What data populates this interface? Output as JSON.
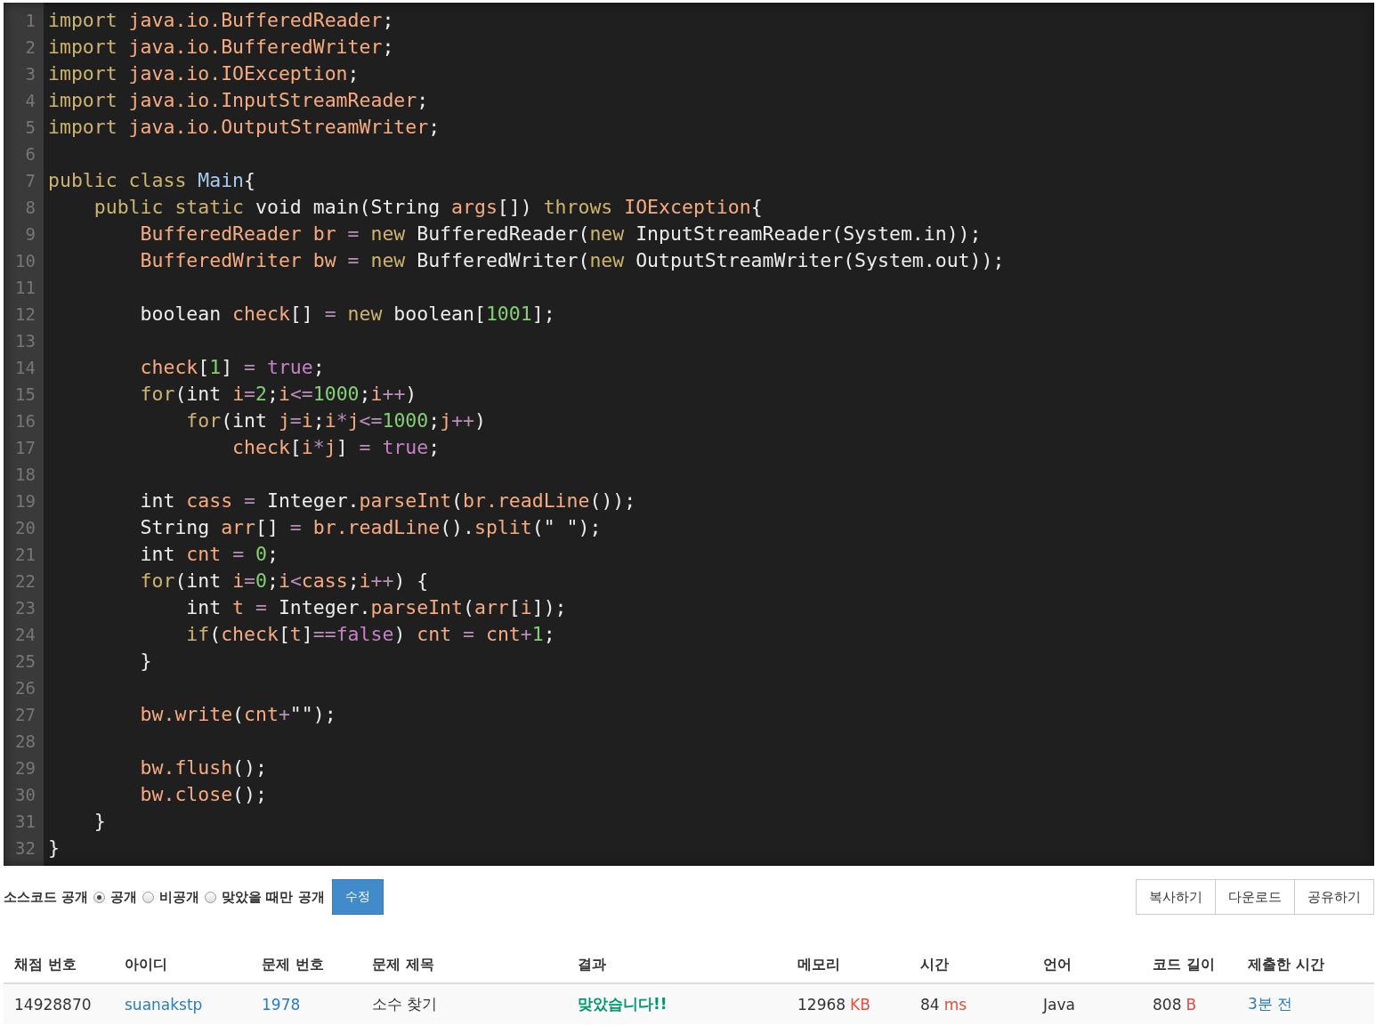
{
  "code_editor": {
    "lines": [
      {
        "number": "1",
        "tokens": [
          {
            "kind": "keyword",
            "text": "import "
          },
          {
            "kind": "variable",
            "text": "java.io.BufferedReader"
          },
          {
            "kind": "plain",
            "text": ";"
          }
        ]
      },
      {
        "number": "2",
        "tokens": [
          {
            "kind": "keyword",
            "text": "import "
          },
          {
            "kind": "variable",
            "text": "java.io.BufferedWriter"
          },
          {
            "kind": "plain",
            "text": ";"
          }
        ]
      },
      {
        "number": "3",
        "tokens": [
          {
            "kind": "keyword",
            "text": "import "
          },
          {
            "kind": "variable",
            "text": "java.io.IOException"
          },
          {
            "kind": "plain",
            "text": ";"
          }
        ]
      },
      {
        "number": "4",
        "tokens": [
          {
            "kind": "keyword",
            "text": "import "
          },
          {
            "kind": "variable",
            "text": "java.io.InputStreamReader"
          },
          {
            "kind": "plain",
            "text": ";"
          }
        ]
      },
      {
        "number": "5",
        "tokens": [
          {
            "kind": "keyword",
            "text": "import "
          },
          {
            "kind": "variable",
            "text": "java.io.OutputStreamWriter"
          },
          {
            "kind": "plain",
            "text": ";"
          }
        ]
      },
      {
        "number": "6"
      },
      {
        "number": "7",
        "tokens": [
          {
            "kind": "keyword",
            "text": "public class "
          },
          {
            "kind": "class",
            "text": "Main"
          },
          {
            "kind": "plain",
            "text": "{"
          }
        ]
      },
      {
        "number": "8",
        "tokens": [
          {
            "kind": "keyword",
            "text": "    public static "
          },
          {
            "kind": "plain",
            "text": "void main(String "
          },
          {
            "kind": "variable",
            "text": "args"
          },
          {
            "kind": "plain",
            "text": "[]) "
          },
          {
            "kind": "keyword",
            "text": "throws "
          },
          {
            "kind": "variable",
            "text": "IOException"
          },
          {
            "kind": "plain",
            "text": "{"
          }
        ]
      },
      {
        "number": "9",
        "tokens": [
          {
            "kind": "variable",
            "text": "        BufferedReader br "
          },
          {
            "kind": "operator",
            "text": "= "
          },
          {
            "kind": "keyword",
            "text": "new "
          },
          {
            "kind": "plain",
            "text": "BufferedReader("
          },
          {
            "kind": "keyword",
            "text": "new "
          },
          {
            "kind": "plain",
            "text": "InputStreamReader(System.in));"
          }
        ]
      },
      {
        "number": "10",
        "tokens": [
          {
            "kind": "variable",
            "text": "        BufferedWriter bw "
          },
          {
            "kind": "operator",
            "text": "= "
          },
          {
            "kind": "keyword",
            "text": "new "
          },
          {
            "kind": "plain",
            "text": "BufferedWriter("
          },
          {
            "kind": "keyword",
            "text": "new "
          },
          {
            "kind": "plain",
            "text": "OutputStreamWriter(System.out));"
          }
        ]
      },
      {
        "number": "11"
      },
      {
        "number": "12",
        "tokens": [
          {
            "kind": "plain",
            "text": "        boolean "
          },
          {
            "kind": "variable",
            "text": "check"
          },
          {
            "kind": "plain",
            "text": "[] "
          },
          {
            "kind": "operator",
            "text": "= "
          },
          {
            "kind": "keyword",
            "text": "new "
          },
          {
            "kind": "plain",
            "text": "boolean["
          },
          {
            "kind": "number",
            "text": "1001"
          },
          {
            "kind": "plain",
            "text": "];"
          }
        ]
      },
      {
        "number": "13"
      },
      {
        "number": "14",
        "tokens": [
          {
            "kind": "variable",
            "text": "        check"
          },
          {
            "kind": "plain",
            "text": "["
          },
          {
            "kind": "number",
            "text": "1"
          },
          {
            "kind": "plain",
            "text": "] "
          },
          {
            "kind": "operator",
            "text": "= "
          },
          {
            "kind": "literal",
            "text": "true"
          },
          {
            "kind": "plain",
            "text": ";"
          }
        ]
      },
      {
        "number": "15",
        "tokens": [
          {
            "kind": "keyword",
            "text": "        for"
          },
          {
            "kind": "plain",
            "text": "(int "
          },
          {
            "kind": "variable",
            "text": "i"
          },
          {
            "kind": "operator",
            "text": "="
          },
          {
            "kind": "number",
            "text": "2"
          },
          {
            "kind": "plain",
            "text": ";"
          },
          {
            "kind": "variable",
            "text": "i"
          },
          {
            "kind": "operator",
            "text": "<="
          },
          {
            "kind": "number",
            "text": "1000"
          },
          {
            "kind": "plain",
            "text": ";"
          },
          {
            "kind": "variable",
            "text": "i"
          },
          {
            "kind": "operator",
            "text": "++"
          },
          {
            "kind": "plain",
            "text": ")"
          }
        ]
      },
      {
        "number": "16",
        "tokens": [
          {
            "kind": "keyword",
            "text": "            for"
          },
          {
            "kind": "plain",
            "text": "(int "
          },
          {
            "kind": "variable",
            "text": "j"
          },
          {
            "kind": "operator",
            "text": "="
          },
          {
            "kind": "variable",
            "text": "i"
          },
          {
            "kind": "plain",
            "text": ";"
          },
          {
            "kind": "variable",
            "text": "i"
          },
          {
            "kind": "operator",
            "text": "*"
          },
          {
            "kind": "variable",
            "text": "j"
          },
          {
            "kind": "operator",
            "text": "<="
          },
          {
            "kind": "number",
            "text": "1000"
          },
          {
            "kind": "plain",
            "text": ";"
          },
          {
            "kind": "variable",
            "text": "j"
          },
          {
            "kind": "operator",
            "text": "++"
          },
          {
            "kind": "plain",
            "text": ")"
          }
        ]
      },
      {
        "number": "17",
        "tokens": [
          {
            "kind": "variable",
            "text": "                check"
          },
          {
            "kind": "plain",
            "text": "["
          },
          {
            "kind": "variable",
            "text": "i"
          },
          {
            "kind": "operator",
            "text": "*"
          },
          {
            "kind": "variable",
            "text": "j"
          },
          {
            "kind": "plain",
            "text": "] "
          },
          {
            "kind": "operator",
            "text": "= "
          },
          {
            "kind": "literal",
            "text": "true"
          },
          {
            "kind": "plain",
            "text": ";"
          }
        ]
      },
      {
        "number": "18"
      },
      {
        "number": "19",
        "tokens": [
          {
            "kind": "plain",
            "text": "        int "
          },
          {
            "kind": "variable",
            "text": "cass "
          },
          {
            "kind": "operator",
            "text": "= "
          },
          {
            "kind": "plain",
            "text": "Integer."
          },
          {
            "kind": "variable",
            "text": "parseInt"
          },
          {
            "kind": "plain",
            "text": "("
          },
          {
            "kind": "variable",
            "text": "br.readLine"
          },
          {
            "kind": "plain",
            "text": "());"
          }
        ]
      },
      {
        "number": "20",
        "tokens": [
          {
            "kind": "plain",
            "text": "        String "
          },
          {
            "kind": "variable",
            "text": "arr"
          },
          {
            "kind": "plain",
            "text": "[] "
          },
          {
            "kind": "operator",
            "text": "= "
          },
          {
            "kind": "variable",
            "text": "br.readLine"
          },
          {
            "kind": "plain",
            "text": "()."
          },
          {
            "kind": "variable",
            "text": "split"
          },
          {
            "kind": "plain",
            "text": "(\" \");"
          }
        ]
      },
      {
        "number": "21",
        "tokens": [
          {
            "kind": "plain",
            "text": "        int "
          },
          {
            "kind": "variable",
            "text": "cnt "
          },
          {
            "kind": "operator",
            "text": "= "
          },
          {
            "kind": "number",
            "text": "0"
          },
          {
            "kind": "plain",
            "text": ";"
          }
        ]
      },
      {
        "number": "22",
        "tokens": [
          {
            "kind": "keyword",
            "text": "        for"
          },
          {
            "kind": "plain",
            "text": "(int "
          },
          {
            "kind": "variable",
            "text": "i"
          },
          {
            "kind": "operator",
            "text": "="
          },
          {
            "kind": "number",
            "text": "0"
          },
          {
            "kind": "plain",
            "text": ";"
          },
          {
            "kind": "variable",
            "text": "i"
          },
          {
            "kind": "operator",
            "text": "<"
          },
          {
            "kind": "variable",
            "text": "cass"
          },
          {
            "kind": "plain",
            "text": ";"
          },
          {
            "kind": "variable",
            "text": "i"
          },
          {
            "kind": "operator",
            "text": "++"
          },
          {
            "kind": "plain",
            "text": ") {"
          }
        ]
      },
      {
        "number": "23",
        "tokens": [
          {
            "kind": "plain",
            "text": "            int "
          },
          {
            "kind": "variable",
            "text": "t "
          },
          {
            "kind": "operator",
            "text": "= "
          },
          {
            "kind": "plain",
            "text": "Integer."
          },
          {
            "kind": "variable",
            "text": "parseInt"
          },
          {
            "kind": "plain",
            "text": "("
          },
          {
            "kind": "variable",
            "text": "arr"
          },
          {
            "kind": "plain",
            "text": "["
          },
          {
            "kind": "variable",
            "text": "i"
          },
          {
            "kind": "plain",
            "text": "]);"
          }
        ]
      },
      {
        "number": "24",
        "tokens": [
          {
            "kind": "keyword",
            "text": "            if"
          },
          {
            "kind": "plain",
            "text": "("
          },
          {
            "kind": "variable",
            "text": "check"
          },
          {
            "kind": "plain",
            "text": "["
          },
          {
            "kind": "variable",
            "text": "t"
          },
          {
            "kind": "plain",
            "text": "]"
          },
          {
            "kind": "operator",
            "text": "=="
          },
          {
            "kind": "literal",
            "text": "false"
          },
          {
            "kind": "plain",
            "text": ") "
          },
          {
            "kind": "variable",
            "text": "cnt "
          },
          {
            "kind": "operator",
            "text": "= "
          },
          {
            "kind": "variable",
            "text": "cnt"
          },
          {
            "kind": "operator",
            "text": "+"
          },
          {
            "kind": "number",
            "text": "1"
          },
          {
            "kind": "plain",
            "text": ";"
          }
        ]
      },
      {
        "number": "25",
        "tokens": [
          {
            "kind": "plain",
            "text": "        }"
          }
        ]
      },
      {
        "number": "26"
      },
      {
        "number": "27",
        "tokens": [
          {
            "kind": "variable",
            "text": "        bw.write"
          },
          {
            "kind": "plain",
            "text": "("
          },
          {
            "kind": "variable",
            "text": "cnt"
          },
          {
            "kind": "operator",
            "text": "+"
          },
          {
            "kind": "plain",
            "text": "\"\");"
          }
        ]
      },
      {
        "number": "28"
      },
      {
        "number": "29",
        "tokens": [
          {
            "kind": "variable",
            "text": "        bw.flush"
          },
          {
            "kind": "plain",
            "text": "();"
          }
        ]
      },
      {
        "number": "30",
        "tokens": [
          {
            "kind": "variable",
            "text": "        bw.close"
          },
          {
            "kind": "plain",
            "text": "();"
          }
        ]
      },
      {
        "number": "31",
        "tokens": [
          {
            "kind": "plain",
            "text": "    }"
          }
        ]
      },
      {
        "number": "32",
        "tokens": [
          {
            "kind": "plain",
            "text": "}"
          }
        ]
      }
    ]
  },
  "visibility": {
    "label": "소스코드 공개",
    "options": [
      {
        "label": "공개",
        "selected": true
      },
      {
        "label": "비공개",
        "selected": false
      },
      {
        "label": "맞았을 때만 공개",
        "selected": false
      }
    ],
    "save_button": "수정"
  },
  "actions": [
    "복사하기",
    "다운로드",
    "공유하기"
  ],
  "table": {
    "columns": [
      "채점 번호",
      "아이디",
      "문제 번호",
      "문제 제목",
      "결과",
      "메모리",
      "시간",
      "언어",
      "코드 길이",
      "제출한 시간"
    ],
    "rows": [
      [
        {
          "kind": "plain",
          "text": "14928870"
        },
        {
          "kind": "link",
          "text": "suanakstp"
        },
        {
          "kind": "link",
          "text": "1978"
        },
        {
          "kind": "plain",
          "text": "소수 찾기"
        },
        {
          "kind": "result",
          "text": "맞았습니다!!"
        },
        {
          "kind": "plain",
          "text": "12968",
          "unit": "KB"
        },
        {
          "kind": "plain",
          "text": "84",
          "unit": "ms"
        },
        {
          "kind": "plain",
          "text": "Java"
        },
        {
          "kind": "plain",
          "text": "808",
          "unit": "B"
        },
        {
          "kind": "link",
          "text": "3분 전"
        }
      ]
    ]
  }
}
